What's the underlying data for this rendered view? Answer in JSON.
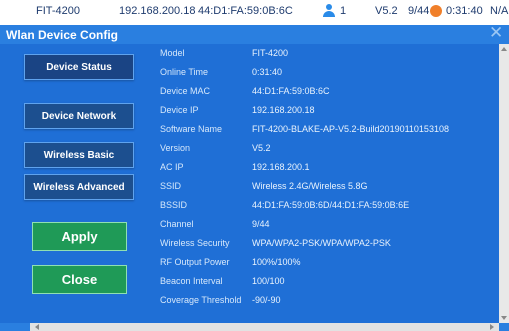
{
  "background_row": {
    "model": "FIT-4200",
    "ip": "192.168.200.18",
    "mac": "44:D1:FA:59:0B:6C",
    "users": "1",
    "version": "V5.2",
    "channel": "9/44",
    "online_time": "0:31:40",
    "extra": "N/A"
  },
  "dialog": {
    "title": "Wlan Device Config",
    "close_glyph": "✕"
  },
  "nav": {
    "device_status": "Device Status",
    "device_network": "Device Network",
    "wireless_basic": "Wireless Basic",
    "wireless_advanced": "Wireless Advanced"
  },
  "actions": {
    "apply": "Apply",
    "close": "Close"
  },
  "info": {
    "rows": [
      {
        "label": "Model",
        "value": "FIT-4200"
      },
      {
        "label": "Online Time",
        "value": "0:31:40"
      },
      {
        "label": "Device MAC",
        "value": "44:D1:FA:59:0B:6C"
      },
      {
        "label": "Device IP",
        "value": "192.168.200.18"
      },
      {
        "label": "Software Name",
        "value": "FIT-4200-BLAKE-AP-V5.2-Build20190110153108"
      },
      {
        "label": "Version",
        "value": "V5.2"
      },
      {
        "label": "AC IP",
        "value": "192.168.200.1"
      },
      {
        "label": "SSID",
        "value": "Wireless 2.4G/Wireless 5.8G"
      },
      {
        "label": "BSSID",
        "value": "44:D1:FA:59:0B:6D/44:D1:FA:59:0B:6E"
      },
      {
        "label": "Channel",
        "value": "9/44"
      },
      {
        "label": "Wireless Security",
        "value": "WPA/WPA2-PSK/WPA/WPA2-PSK"
      },
      {
        "label": "RF Output Power",
        "value": "100%/100%"
      },
      {
        "label": "Beacon Interval",
        "value": "100/100"
      },
      {
        "label": "Coverage Threshold",
        "value": "-90/-90"
      }
    ]
  },
  "colors": {
    "dialog_bg": "#2a7fe0",
    "content_bg": "#1f6fd6",
    "nav_button": "#1c4f8f",
    "action_button": "#1f9a57"
  }
}
